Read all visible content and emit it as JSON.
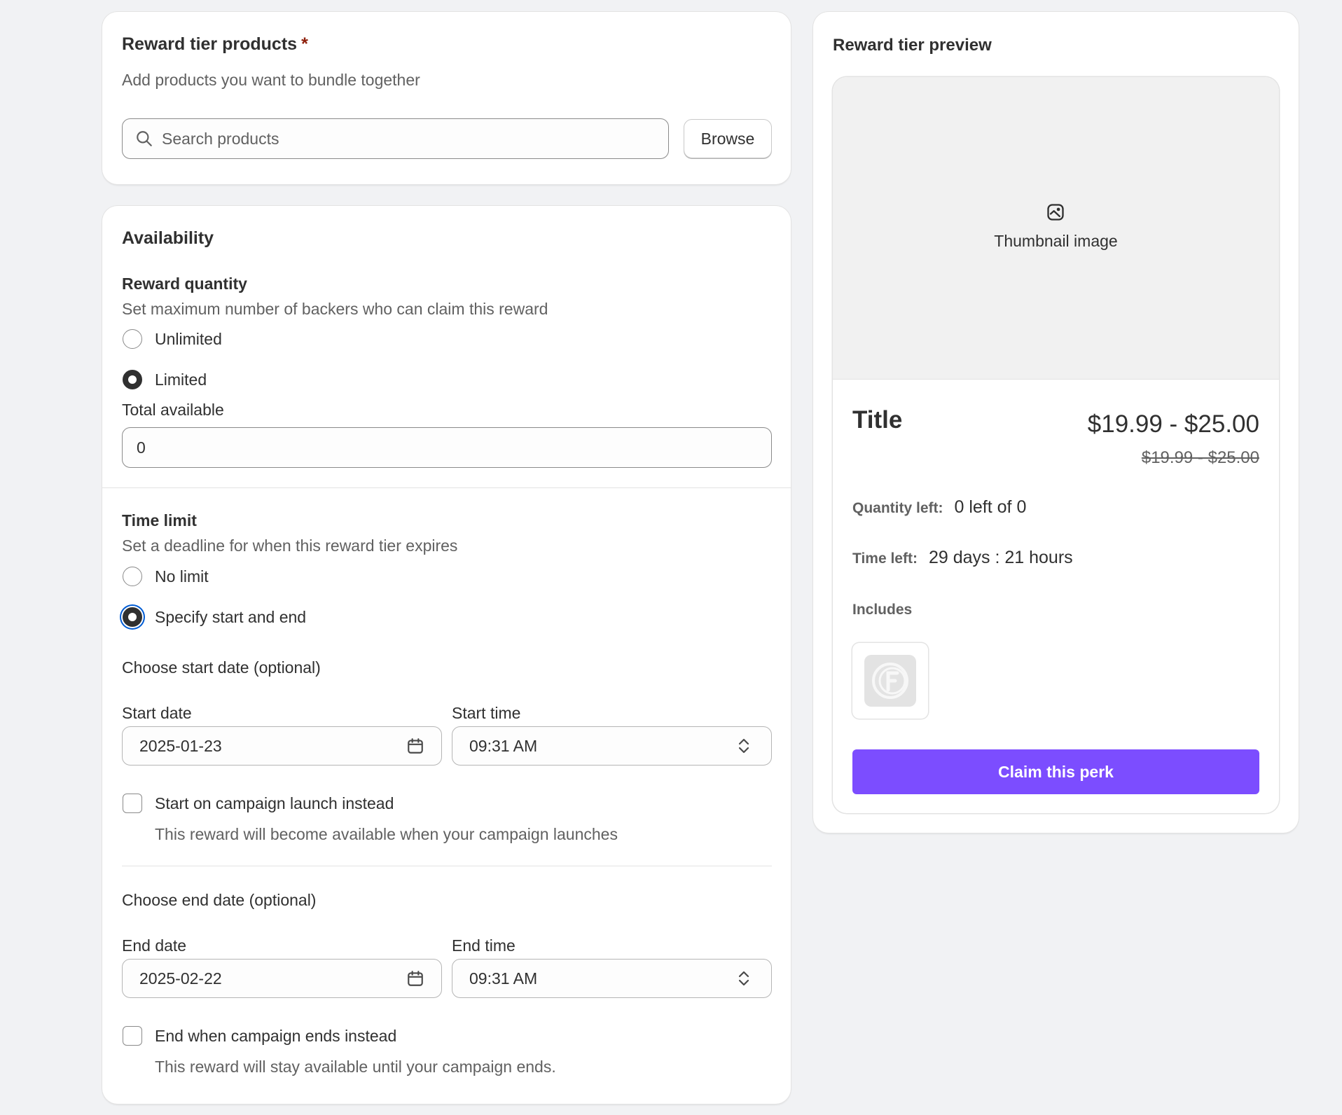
{
  "products": {
    "title": "Reward tier products",
    "required_mark": "*",
    "subtitle": "Add products you want to bundle together",
    "search_placeholder": "Search products",
    "browse_label": "Browse"
  },
  "availability": {
    "title": "Availability",
    "reward_quantity": {
      "label": "Reward quantity",
      "help": "Set maximum number of backers who can claim this reward",
      "options": [
        "Unlimited",
        "Limited"
      ],
      "selected": "Limited",
      "total_label": "Total available",
      "total_value": "0"
    },
    "time_limit": {
      "label": "Time limit",
      "help": "Set a deadline for when this reward tier expires",
      "options": [
        "No limit",
        "Specify start and end"
      ],
      "selected": "Specify start and end"
    },
    "start": {
      "heading": "Choose start date (optional)",
      "date_label": "Start date",
      "date_value": "2025-01-23",
      "time_label": "Start time",
      "time_value": "09:31 AM",
      "checkbox_label": "Start on campaign launch instead",
      "checkbox_help": "This reward will become available when your campaign launches",
      "checked": false
    },
    "end": {
      "heading": "Choose end date (optional)",
      "date_label": "End date",
      "date_value": "2025-02-22",
      "time_label": "End time",
      "time_value": "09:31 AM",
      "checkbox_label": "End when campaign ends instead",
      "checkbox_help": "This reward will stay available until your campaign ends.",
      "checked": false
    }
  },
  "preview": {
    "title": "Reward tier preview",
    "thumbnail_text": "Thumbnail image",
    "item_title": "Title",
    "price": "$19.99 - $25.00",
    "compare_price": "$19.99 - $25.00",
    "quantity_label": "Quantity left:",
    "quantity_value": "0 left of 0",
    "time_label": "Time left:",
    "time_value": "29 days : 21 hours",
    "includes_label": "Includes",
    "claim_label": "Claim this perk",
    "accent_color": "#7c4dff"
  }
}
